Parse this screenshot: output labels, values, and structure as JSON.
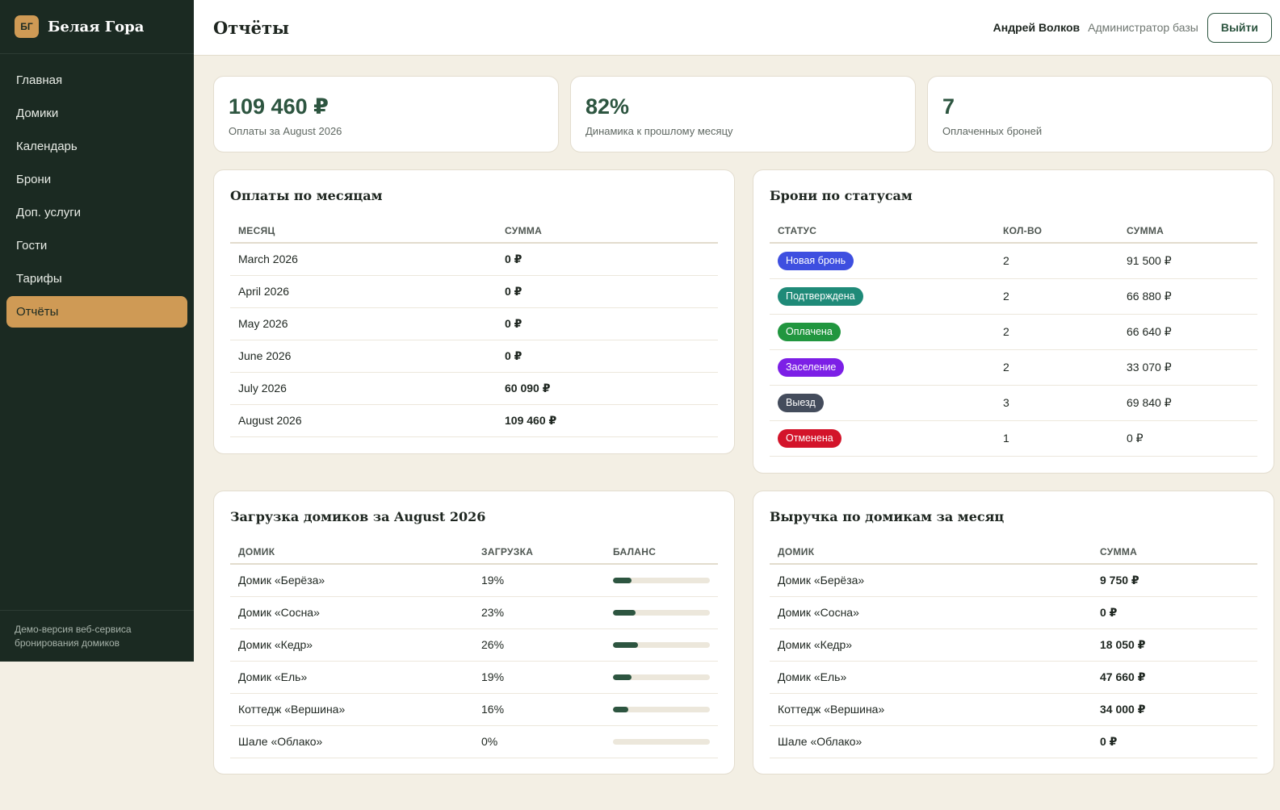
{
  "brand": {
    "logo_text": "БГ",
    "name": "Белая Гора"
  },
  "sidebar": {
    "items": [
      {
        "label": "Главная",
        "active": false
      },
      {
        "label": "Домики",
        "active": false
      },
      {
        "label": "Календарь",
        "active": false
      },
      {
        "label": "Брони",
        "active": false
      },
      {
        "label": "Доп. услуги",
        "active": false
      },
      {
        "label": "Гости",
        "active": false
      },
      {
        "label": "Тарифы",
        "active": false
      },
      {
        "label": "Отчёты",
        "active": true
      }
    ],
    "footer": "Демо-версия веб-сервиса бронирования домиков"
  },
  "header": {
    "title": "Отчёты",
    "user_name": "Андрей Волков",
    "user_role": "Администратор базы",
    "logout_label": "Выйти"
  },
  "stats": [
    {
      "value": "109 460 ₽",
      "label": "Оплаты за August 2026"
    },
    {
      "value": "82%",
      "label": "Динамика к прошлому месяцу"
    },
    {
      "value": "7",
      "label": "Оплаченных броней"
    }
  ],
  "payments_by_month": {
    "title": "Оплаты по месяцам",
    "columns": [
      "Месяц",
      "Сумма"
    ],
    "rows": [
      {
        "month": "March 2026",
        "sum": "0 ₽"
      },
      {
        "month": "April 2026",
        "sum": "0 ₽"
      },
      {
        "month": "May 2026",
        "sum": "0 ₽"
      },
      {
        "month": "June 2026",
        "sum": "0 ₽"
      },
      {
        "month": "July 2026",
        "sum": "60 090 ₽"
      },
      {
        "month": "August 2026",
        "sum": "109 460 ₽"
      }
    ]
  },
  "bookings_by_status": {
    "title": "Брони по статусам",
    "columns": [
      "Статус",
      "Кол-во",
      "Сумма"
    ],
    "rows": [
      {
        "status": "Новая бронь",
        "color": "#3e4fe0",
        "count": "2",
        "sum": "91 500 ₽"
      },
      {
        "status": "Подтверждена",
        "color": "#1f8a78",
        "count": "2",
        "sum": "66 880 ₽"
      },
      {
        "status": "Оплачена",
        "color": "#21963f",
        "count": "2",
        "sum": "66 640 ₽"
      },
      {
        "status": "Заселение",
        "color": "#7c1fe6",
        "count": "2",
        "sum": "33 070 ₽"
      },
      {
        "status": "Выезд",
        "color": "#444c5c",
        "count": "3",
        "sum": "69 840 ₽"
      },
      {
        "status": "Отменена",
        "color": "#d3142a",
        "count": "1",
        "sum": "0 ₽"
      }
    ]
  },
  "occupancy": {
    "title": "Загрузка домиков за August 2026",
    "columns": [
      "Домик",
      "Загрузка",
      "Баланс"
    ],
    "rows": [
      {
        "house": "Домик «Берёза»",
        "load": "19%",
        "fraction": 0.19
      },
      {
        "house": "Домик «Сосна»",
        "load": "23%",
        "fraction": 0.23
      },
      {
        "house": "Домик «Кедр»",
        "load": "26%",
        "fraction": 0.26
      },
      {
        "house": "Домик «Ель»",
        "load": "19%",
        "fraction": 0.19
      },
      {
        "house": "Коттедж «Вершина»",
        "load": "16%",
        "fraction": 0.16
      },
      {
        "house": "Шале «Облако»",
        "load": "0%",
        "fraction": 0
      }
    ]
  },
  "revenue_by_house": {
    "title": "Выручка по домикам за месяц",
    "columns": [
      "Домик",
      "Сумма"
    ],
    "rows": [
      {
        "house": "Домик «Берёза»",
        "sum": "9 750 ₽"
      },
      {
        "house": "Домик «Сосна»",
        "sum": "0 ₽"
      },
      {
        "house": "Домик «Кедр»",
        "sum": "18 050 ₽"
      },
      {
        "house": "Домик «Ель»",
        "sum": "47 660 ₽"
      },
      {
        "house": "Коттедж «Вершина»",
        "sum": "34 000 ₽"
      },
      {
        "house": "Шале «Облако»",
        "sum": "0 ₽"
      }
    ]
  }
}
